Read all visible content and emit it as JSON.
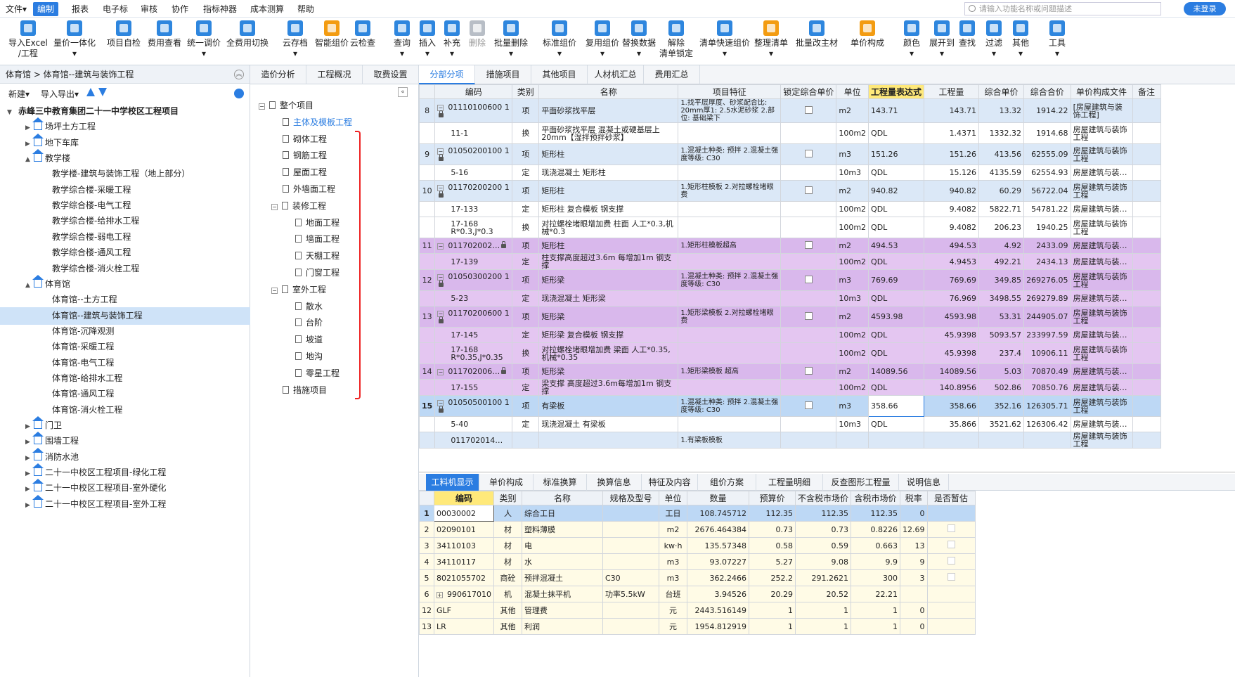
{
  "menu": {
    "items": [
      "文件▾",
      "编制",
      "报表",
      "电子标",
      "审核",
      "协作",
      "指标神器",
      "成本测算",
      "帮助"
    ],
    "search_placeholder": "请输入功能名称或问题描述",
    "login": "未登录"
  },
  "toolbar": [
    {
      "l1": "导入Excel",
      "l2": "/工程",
      "icon": "import-excel-icon",
      "color": "blue"
    },
    {
      "l1": "量价一体化",
      "l2": "▾",
      "icon": "quantity-price-icon",
      "color": "blue"
    },
    {
      "l1": "项目自检",
      "l2": "",
      "icon": "self-check-icon",
      "color": "blue"
    },
    {
      "l1": "费用查看",
      "l2": "",
      "icon": "cost-view-icon",
      "color": "blue"
    },
    {
      "l1": "统一调价",
      "l2": "▾",
      "icon": "adjust-price-icon",
      "color": "blue"
    },
    {
      "l1": "全费用切换",
      "l2": "",
      "icon": "full-cost-switch-icon",
      "color": "blue"
    },
    {
      "l1": "云存档",
      "l2": "▾",
      "icon": "cloud-save-icon",
      "color": "blue"
    },
    {
      "l1": "智能组价",
      "l2": "",
      "icon": "smart-price-icon",
      "color": "orange"
    },
    {
      "l1": "云检查",
      "l2": "",
      "icon": "cloud-check-icon",
      "color": "blue"
    },
    {
      "l1": "查询",
      "l2": "▾",
      "icon": "query-icon",
      "color": "blue"
    },
    {
      "l1": "插入",
      "l2": "▾",
      "icon": "insert-icon",
      "color": "blue"
    },
    {
      "l1": "补充",
      "l2": "▾",
      "icon": "supplement-icon",
      "color": "blue"
    },
    {
      "l1": "删除",
      "l2": "",
      "icon": "delete-icon",
      "color": "grey",
      "disabled": true
    },
    {
      "l1": "批量删除",
      "l2": "▾",
      "icon": "batch-delete-icon",
      "color": "blue"
    },
    {
      "l1": "标准组价",
      "l2": "▾",
      "icon": "standard-price-icon",
      "color": "blue"
    },
    {
      "l1": "复用组价",
      "l2": "▾",
      "icon": "reuse-price-icon",
      "color": "blue"
    },
    {
      "l1": "替换数据",
      "l2": "▾",
      "icon": "replace-data-icon",
      "color": "blue"
    },
    {
      "l1": "解除",
      "l2": "清单锁定",
      "icon": "unlock-icon",
      "color": "blue"
    },
    {
      "l1": "清单快速组价",
      "l2": "▾",
      "icon": "quick-price-icon",
      "color": "blue"
    },
    {
      "l1": "整理清单",
      "l2": "▾",
      "icon": "organize-list-icon",
      "color": "orange"
    },
    {
      "l1": "批量改主材",
      "l2": "",
      "icon": "batch-material-icon",
      "color": "blue"
    },
    {
      "l1": "单价构成",
      "l2": "",
      "icon": "unit-price-icon",
      "color": "orange"
    },
    {
      "l1": "颜色",
      "l2": "▾",
      "icon": "color-icon",
      "color": "blue"
    },
    {
      "l1": "展开到",
      "l2": "▾",
      "icon": "expand-to-icon",
      "color": "blue"
    },
    {
      "l1": "查找",
      "l2": "",
      "icon": "find-icon",
      "color": "blue"
    },
    {
      "l1": "过滤",
      "l2": "▾",
      "icon": "filter-icon",
      "color": "blue"
    },
    {
      "l1": "其他",
      "l2": "▾",
      "icon": "other-icon",
      "color": "blue"
    },
    {
      "l1": "工具",
      "l2": "▾",
      "icon": "tools-icon",
      "color": "blue"
    }
  ],
  "left": {
    "breadcrumb": "体育馆 > 体育馆--建筑与装饰工程",
    "new": "新建▾",
    "import_export": "导入导出▾",
    "tree": [
      {
        "label": "赤峰三中教育集团二十一中学校区工程项目",
        "level": 0,
        "tri": "▼",
        "bold": true
      },
      {
        "label": "场坪土方工程",
        "level": 1,
        "tri": "▶",
        "house": true
      },
      {
        "label": "地下车库",
        "level": 1,
        "tri": "▶",
        "house": true
      },
      {
        "label": "教学楼",
        "level": 1,
        "tri": "▲",
        "house": true
      },
      {
        "label": "教学楼-建筑与装饰工程（地上部分）",
        "level": 2
      },
      {
        "label": "教学综合楼-采暖工程",
        "level": 2
      },
      {
        "label": "教学综合楼-电气工程",
        "level": 2
      },
      {
        "label": "教学综合楼-给排水工程",
        "level": 2
      },
      {
        "label": "教学综合楼-弱电工程",
        "level": 2
      },
      {
        "label": "教学综合楼-通风工程",
        "level": 2
      },
      {
        "label": "教学综合楼-消火栓工程",
        "level": 2
      },
      {
        "label": "体育馆",
        "level": 1,
        "tri": "▲",
        "house": true
      },
      {
        "label": "体育馆--土方工程",
        "level": 2
      },
      {
        "label": "体育馆--建筑与装饰工程",
        "level": 2,
        "selected": true
      },
      {
        "label": "体育馆-沉降观测",
        "level": 2
      },
      {
        "label": "体育馆-采暖工程",
        "level": 2
      },
      {
        "label": "体育馆-电气工程",
        "level": 2
      },
      {
        "label": "体育馆-给排水工程",
        "level": 2
      },
      {
        "label": "体育馆-通风工程",
        "level": 2
      },
      {
        "label": "体育馆-消火栓工程",
        "level": 2
      },
      {
        "label": "门卫",
        "level": 1,
        "tri": "▶",
        "house": true
      },
      {
        "label": "围墙工程",
        "level": 1,
        "tri": "▶",
        "house": true
      },
      {
        "label": "消防水池",
        "level": 1,
        "tri": "▶",
        "house": true
      },
      {
        "label": "二十一中校区工程项目-绿化工程",
        "level": 1,
        "tri": "▶",
        "house": true
      },
      {
        "label": "二十一中校区工程项目-室外硬化",
        "level": 1,
        "tri": "▶",
        "house": true
      },
      {
        "label": "二十一中校区工程项目-室外工程",
        "level": 1,
        "tri": "▶",
        "house": true
      }
    ]
  },
  "mid": {
    "tree": [
      {
        "label": "整个项目",
        "level": 0,
        "pm": "−"
      },
      {
        "label": "主体及模板工程",
        "level": 1,
        "selected": true
      },
      {
        "label": "砌体工程",
        "level": 1
      },
      {
        "label": "钢筋工程",
        "level": 1
      },
      {
        "label": "屋面工程",
        "level": 1
      },
      {
        "label": "外墙面工程",
        "level": 1
      },
      {
        "label": "装修工程",
        "level": 1,
        "pm": "−"
      },
      {
        "label": "地面工程",
        "level": 2
      },
      {
        "label": "墙面工程",
        "level": 2
      },
      {
        "label": "天棚工程",
        "level": 2
      },
      {
        "label": "门窗工程",
        "level": 2
      },
      {
        "label": "室外工程",
        "level": 1,
        "pm": "−"
      },
      {
        "label": "散水",
        "level": 2
      },
      {
        "label": "台阶",
        "level": 2
      },
      {
        "label": "坡道",
        "level": 2
      },
      {
        "label": "地沟",
        "level": 2
      },
      {
        "label": "零星工程",
        "level": 2
      },
      {
        "label": "措施项目",
        "level": 1
      }
    ]
  },
  "tabs": [
    "造价分析",
    "工程概况",
    "取费设置",
    "分部分项",
    "措施项目",
    "其他项目",
    "人材机汇总",
    "费用汇总"
  ],
  "grid": {
    "headers": [
      "",
      "编码",
      "类别",
      "名称",
      "项目特征",
      "锁定综合单价",
      "单位",
      "工程量表达式",
      "工程量",
      "综合单价",
      "综合合价",
      "单价构成文件",
      "备注"
    ],
    "rows": [
      {
        "no": "8",
        "code": "01110100600 1",
        "type": "项",
        "name": "平面砂浆找平层",
        "feat": "1.找平层厚度、砂浆配合比: 20mm厚1: 2.5水泥砂浆 2.部位: 基础梁下",
        "unit": "m2",
        "expr": "143.71",
        "qty": "143.71",
        "price": "13.32",
        "total": "1914.22",
        "file": "[房屋建筑与装饰工程]",
        "cls": "blk",
        "pm": true,
        "cb": true,
        "lock": true
      },
      {
        "no": "",
        "code": "11-1",
        "type": "换",
        "name": "平面砂浆找平层 混凝土或硬基层上 20mm【湿拌预拌砂浆】",
        "feat": "",
        "unit": "100m2",
        "expr": "QDL",
        "qty": "1.4371",
        "price": "1332.32",
        "total": "1914.68",
        "file": "房屋建筑与装饰工程",
        "cls": ""
      },
      {
        "no": "9",
        "code": "01050200100 1",
        "type": "项",
        "name": "矩形柱",
        "feat": "1.混凝土种类: 预拌 2.混凝土强度等级: C30",
        "unit": "m3",
        "expr": "151.26",
        "qty": "151.26",
        "price": "413.56",
        "total": "62555.09",
        "file": "房屋建筑与装饰工程",
        "cls": "blk",
        "pm": true,
        "cb": true,
        "lock": true
      },
      {
        "no": "",
        "code": "5-16",
        "type": "定",
        "name": "现浇混凝土 矩形柱",
        "feat": "",
        "unit": "10m3",
        "expr": "QDL",
        "qty": "15.126",
        "price": "4135.59",
        "total": "62554.93",
        "file": "房屋建筑与装…",
        "cls": ""
      },
      {
        "no": "10",
        "code": "01170200200 1",
        "type": "项",
        "name": "矩形柱",
        "feat": "1.矩形柱模板 2.对拉螺栓堵眼费",
        "unit": "m2",
        "expr": "940.82",
        "qty": "940.82",
        "price": "60.29",
        "total": "56722.04",
        "file": "房屋建筑与装饰工程",
        "cls": "blk",
        "pm": true,
        "cb": true,
        "lock": true
      },
      {
        "no": "",
        "code": "17-133",
        "type": "定",
        "name": "矩形柱 复合模板 钢支撑",
        "feat": "",
        "unit": "100m2",
        "expr": "QDL",
        "qty": "9.4082",
        "price": "5822.71",
        "total": "54781.22",
        "file": "房屋建筑与装…",
        "cls": ""
      },
      {
        "no": "",
        "code": "17-168 R*0.3,J*0.3",
        "type": "换",
        "name": "对拉螺栓堵眼增加费 柱面 人工*0.3,机械*0.3",
        "feat": "",
        "unit": "100m2",
        "expr": "QDL",
        "qty": "9.4082",
        "price": "206.23",
        "total": "1940.25",
        "file": "房屋建筑与装饰工程",
        "cls": ""
      },
      {
        "no": "11",
        "code": "011702002…",
        "type": "项",
        "name": "矩形柱",
        "feat": "1.矩形柱模板超高",
        "unit": "m2",
        "expr": "494.53",
        "qty": "494.53",
        "price": "4.92",
        "total": "2433.09",
        "file": "房屋建筑与装…",
        "cls": "pur",
        "pm": true,
        "cb": true,
        "lock": true
      },
      {
        "no": "",
        "code": "17-139",
        "type": "定",
        "name": "柱支撑高度超过3.6m 每增加1m 钢支撑",
        "feat": "",
        "unit": "100m2",
        "expr": "QDL",
        "qty": "4.9453",
        "price": "492.21",
        "total": "2434.13",
        "file": "房屋建筑与装…",
        "cls": "pur2"
      },
      {
        "no": "12",
        "code": "01050300200 1",
        "type": "项",
        "name": "矩形梁",
        "feat": "1.混凝土种类: 预拌 2.混凝土强度等级: C30",
        "unit": "m3",
        "expr": "769.69",
        "qty": "769.69",
        "price": "349.85",
        "total": "269276.05",
        "file": "房屋建筑与装饰工程",
        "cls": "pur",
        "pm": true,
        "cb": true,
        "lock": true
      },
      {
        "no": "",
        "code": "5-23",
        "type": "定",
        "name": "现浇混凝土 矩形梁",
        "feat": "",
        "unit": "10m3",
        "expr": "QDL",
        "qty": "76.969",
        "price": "3498.55",
        "total": "269279.89",
        "file": "房屋建筑与装…",
        "cls": "pur2"
      },
      {
        "no": "13",
        "code": "01170200600 1",
        "type": "项",
        "name": "矩形梁",
        "feat": "1.矩形梁模板 2.对拉螺栓堵眼费",
        "unit": "m2",
        "expr": "4593.98",
        "qty": "4593.98",
        "price": "53.31",
        "total": "244905.07",
        "file": "房屋建筑与装饰工程",
        "cls": "pur",
        "pm": true,
        "cb": true,
        "lock": true
      },
      {
        "no": "",
        "code": "17-145",
        "type": "定",
        "name": "矩形梁 复合模板 钢支撑",
        "feat": "",
        "unit": "100m2",
        "expr": "QDL",
        "qty": "45.9398",
        "price": "5093.57",
        "total": "233997.59",
        "file": "房屋建筑与装…",
        "cls": "pur2"
      },
      {
        "no": "",
        "code": "17-168 R*0.35,J*0.35",
        "type": "换",
        "name": "对拉螺栓堵眼增加费 梁面 人工*0.35,机械*0.35",
        "feat": "",
        "unit": "100m2",
        "expr": "QDL",
        "qty": "45.9398",
        "price": "237.4",
        "total": "10906.11",
        "file": "房屋建筑与装饰工程",
        "cls": "pur2"
      },
      {
        "no": "14",
        "code": "011702006…",
        "type": "项",
        "name": "矩形梁",
        "feat": "1.矩形梁模板 超高",
        "unit": "m2",
        "expr": "14089.56",
        "qty": "14089.56",
        "price": "5.03",
        "total": "70870.49",
        "file": "房屋建筑与装…",
        "cls": "pur",
        "pm": true,
        "cb": true,
        "lock": true
      },
      {
        "no": "",
        "code": "17-155",
        "type": "定",
        "name": "梁支撑 高度超过3.6m每增加1m 钢支撑",
        "feat": "",
        "unit": "100m2",
        "expr": "QDL",
        "qty": "140.8956",
        "price": "502.86",
        "total": "70850.76",
        "file": "房屋建筑与装…",
        "cls": "pur2"
      },
      {
        "no": "15",
        "code": "01050500100 1",
        "type": "项",
        "name": "有梁板",
        "feat": "1.混凝土种类: 预拌 2.混凝土强度等级: C30",
        "unit": "m3",
        "expr": "358.66",
        "qty": "358.66",
        "price": "352.16",
        "total": "126305.71",
        "file": "房屋建筑与装饰工程",
        "cls": "cur",
        "pm": true,
        "cb": true,
        "lock": true
      },
      {
        "no": "",
        "code": "5-40",
        "type": "定",
        "name": "现浇混凝土 有梁板",
        "feat": "",
        "unit": "10m3",
        "expr": "QDL",
        "qty": "35.866",
        "price": "3521.62",
        "total": "126306.42",
        "file": "房屋建筑与装…",
        "cls": ""
      },
      {
        "no": "",
        "code": "011702014…",
        "type": "",
        "name": "",
        "feat": "1.有梁板模板",
        "unit": "",
        "expr": "",
        "qty": "",
        "price": "",
        "total": "",
        "file": "房屋建筑与装饰工程",
        "cls": "blk"
      }
    ]
  },
  "btabs": [
    "工料机显示",
    "单价构成",
    "标准换算",
    "换算信息",
    "特征及内容",
    "组价方案",
    "工程量明细",
    "反查图形工程量",
    "说明信息"
  ],
  "bgrid": {
    "headers": [
      "",
      "编码",
      "类别",
      "名称",
      "规格及型号",
      "单位",
      "数量",
      "预算价",
      "不含税市场价",
      "含税市场价",
      "税率",
      "是否暂估"
    ],
    "rows": [
      {
        "no": "1",
        "code": "00030002",
        "type": "人",
        "name": "综合工日",
        "spec": "",
        "unit": "工日",
        "qty": "108.745712",
        "budget": "112.35",
        "mkt": "112.35",
        "mkttax": "112.35",
        "tax": "0",
        "est": false,
        "first": true
      },
      {
        "no": "2",
        "code": "02090101",
        "type": "材",
        "name": "塑料薄膜",
        "spec": "",
        "unit": "m2",
        "qty": "2676.464384",
        "budget": "0.73",
        "mkt": "0.73",
        "mkttax": "0.8226",
        "tax": "12.69",
        "est": true
      },
      {
        "no": "3",
        "code": "34110103",
        "type": "材",
        "name": "电",
        "spec": "",
        "unit": "kw·h",
        "qty": "135.57348",
        "budget": "0.58",
        "mkt": "0.59",
        "mkttax": "0.663",
        "tax": "13",
        "est": true
      },
      {
        "no": "4",
        "code": "34110117",
        "type": "材",
        "name": "水",
        "spec": "",
        "unit": "m3",
        "qty": "93.07227",
        "budget": "5.27",
        "mkt": "9.08",
        "mkttax": "9.9",
        "tax": "9",
        "est": true
      },
      {
        "no": "5",
        "code": "8021055702",
        "type": "商砼",
        "name": "预拌混凝土",
        "spec": "C30",
        "unit": "m3",
        "qty": "362.2466",
        "budget": "252.2",
        "mkt": "291.2621",
        "mkttax": "300",
        "tax": "3",
        "est": true
      },
      {
        "no": "6",
        "code": "990617010",
        "type": "机",
        "name": "混凝土抹平机",
        "spec": "功率5.5kW",
        "unit": "台班",
        "qty": "3.94526",
        "budget": "20.29",
        "mkt": "20.52",
        "mkttax": "22.21",
        "tax": "",
        "est": false,
        "plus": true
      },
      {
        "no": "12",
        "code": "GLF",
        "type": "其他",
        "name": "管理费",
        "spec": "",
        "unit": "元",
        "qty": "2443.516149",
        "budget": "1",
        "mkt": "1",
        "mkttax": "1",
        "tax": "0",
        "est": false
      },
      {
        "no": "13",
        "code": "LR",
        "type": "其他",
        "name": "利润",
        "spec": "",
        "unit": "元",
        "qty": "1954.812919",
        "budget": "1",
        "mkt": "1",
        "mkttax": "1",
        "tax": "0",
        "est": false
      }
    ]
  }
}
